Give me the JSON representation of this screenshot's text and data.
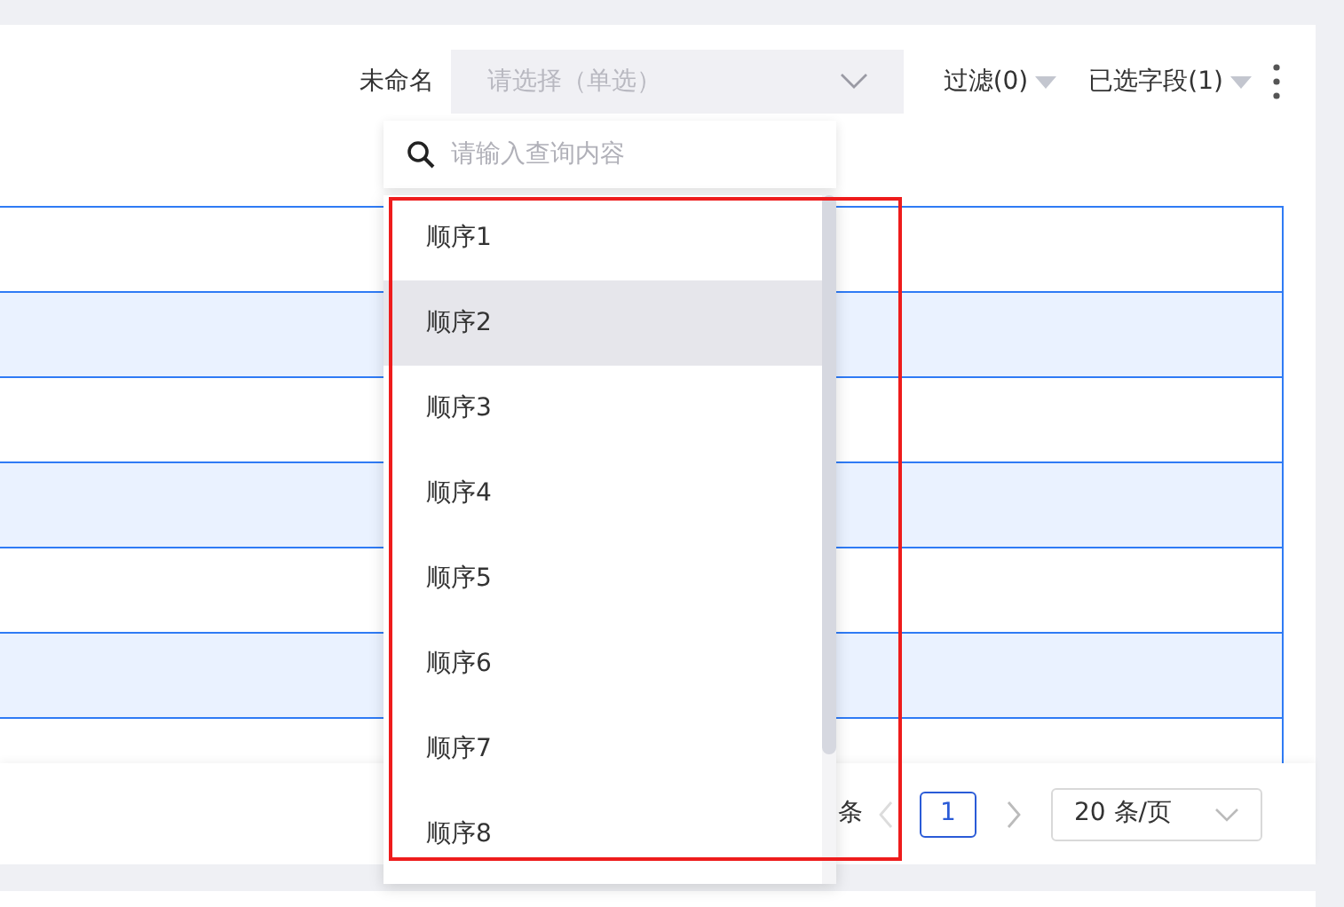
{
  "toolbar": {
    "label": "未命名",
    "select": {
      "placeholder": "请选择（单选）"
    },
    "filter": "过滤(0)",
    "fields": "已选字段(1)"
  },
  "pagination": {
    "total_suffix": "条",
    "pages": [
      {
        "label": "1",
        "selected": true
      }
    ],
    "prev_disabled": true,
    "page_size": "20 条/页"
  },
  "dropdown": {
    "search": {
      "placeholder": "请输入查询内容"
    },
    "options": [
      {
        "label": "顺序1",
        "highlighted": false
      },
      {
        "label": "顺序2",
        "highlighted": true
      },
      {
        "label": "顺序3",
        "highlighted": false
      },
      {
        "label": "顺序4",
        "highlighted": false
      },
      {
        "label": "顺序5",
        "highlighted": false
      },
      {
        "label": "顺序6",
        "highlighted": false
      },
      {
        "label": "顺序7",
        "highlighted": false
      },
      {
        "label": "顺序8",
        "highlighted": false
      }
    ]
  }
}
